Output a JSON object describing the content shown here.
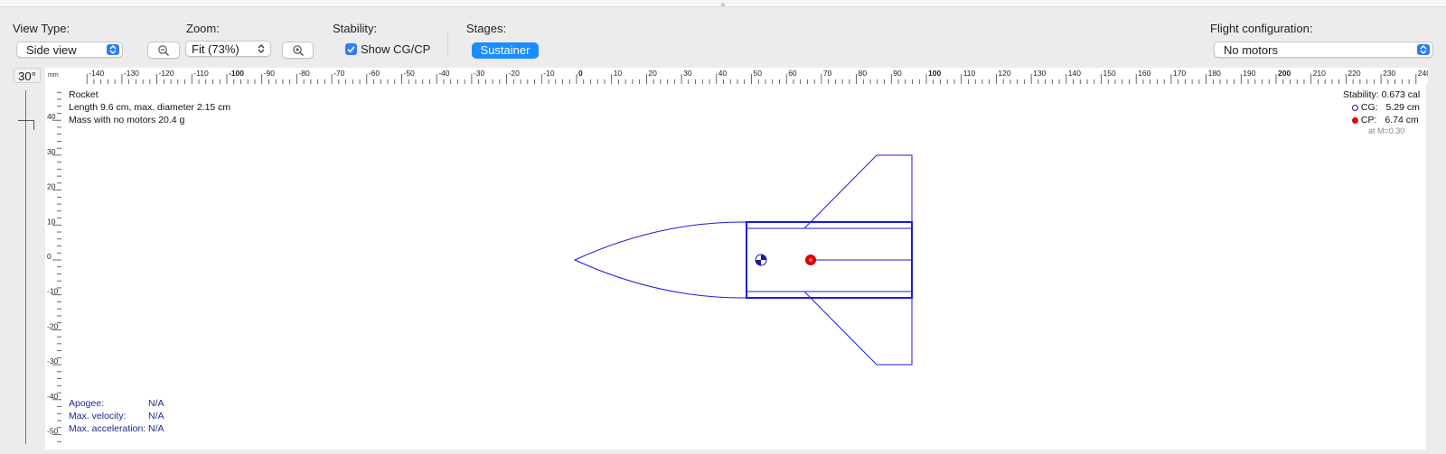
{
  "toolbar": {
    "view_type_label": "View Type:",
    "view_type_value": "Side view",
    "zoom_label": "Zoom:",
    "zoom_value": "Fit (73%)",
    "stability_label": "Stability:",
    "show_cgcp_label": "Show CG/CP",
    "show_cgcp_checked": true,
    "stages_label": "Stages:",
    "stage_button": "Sustainer",
    "flight_config_label": "Flight configuration:",
    "flight_config_value": "No motors"
  },
  "view": {
    "rotation_angle": "30°",
    "ruler_unit": "mm",
    "ruler_x_ticks": [
      -140,
      -130,
      -120,
      -110,
      -100,
      -90,
      -80,
      -70,
      -60,
      -50,
      -40,
      -30,
      -20,
      -10,
      0,
      10,
      20,
      30,
      40,
      50,
      60,
      70,
      80,
      90,
      100,
      110,
      120,
      130,
      140,
      150,
      160,
      170,
      180,
      190,
      200,
      210,
      220,
      230,
      240
    ],
    "ruler_y_ticks": [
      40,
      30,
      20,
      10,
      0,
      -10,
      -20,
      -30,
      -40,
      -50
    ]
  },
  "rocket_info": {
    "name": "Rocket",
    "dimensions": "Length 9.6 cm, max. diameter 2.15 cm",
    "mass": "Mass with no motors 20.4 g"
  },
  "stability_info": {
    "stability_label": "Stability:",
    "stability_value": "0.673 cal",
    "cg_label": "CG:",
    "cg_value": "5.29 cm",
    "cp_label": "CP:",
    "cp_value": "6.74 cm",
    "mach_note": "at M=0.30"
  },
  "flight_data": {
    "apogee_label": "Apogee:",
    "apogee_value": "N/A",
    "max_velocity_label": "Max. velocity:",
    "max_velocity_value": "N/A",
    "max_accel_label": "Max. acceleration:",
    "max_accel_value": "N/A"
  },
  "colors": {
    "accent": "#1a8cff",
    "rocket_outline": "#1a1ae6",
    "cp_marker": "#e00000",
    "flight_text": "#1a2a8c"
  }
}
